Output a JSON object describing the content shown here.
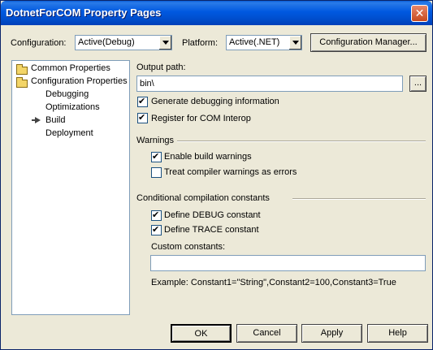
{
  "window": {
    "title": "DotnetForCOM Property Pages"
  },
  "toolbar": {
    "configuration_label": "Configuration:",
    "configuration_value": "Active(Debug)",
    "platform_label": "Platform:",
    "platform_value": "Active(.NET)",
    "config_manager_label": "Configuration Manager..."
  },
  "tree": {
    "items": [
      {
        "label": "Common Properties",
        "icon": "folder-icon"
      },
      {
        "label": "Configuration Properties",
        "icon": "folder-open-icon"
      },
      {
        "label": "Debugging"
      },
      {
        "label": "Optimizations"
      },
      {
        "label": "Build",
        "selected": true,
        "icon": "arrow-right-icon"
      },
      {
        "label": "Deployment"
      }
    ]
  },
  "build": {
    "output_path_label": "Output path:",
    "output_path_value": "bin\\",
    "browse_label": "...",
    "generate_debug_label": "Generate debugging information",
    "generate_debug_checked": true,
    "register_com_label": "Register for COM Interop",
    "register_com_checked": true,
    "warnings_heading": "Warnings",
    "enable_warnings_label": "Enable build warnings",
    "enable_warnings_checked": true,
    "treat_errors_label": "Treat compiler warnings as errors",
    "treat_errors_checked": false,
    "conditional_heading": "Conditional compilation constants",
    "define_debug_label": "Define DEBUG constant",
    "define_debug_checked": true,
    "define_trace_label": "Define TRACE constant",
    "define_trace_checked": true,
    "custom_constants_label": "Custom constants:",
    "custom_constants_value": "",
    "example_text": "Example: Constant1=\"String\",Constant2=100,Constant3=True"
  },
  "footer": {
    "ok_label": "OK",
    "cancel_label": "Cancel",
    "apply_label": "Apply",
    "help_label": "Help"
  }
}
